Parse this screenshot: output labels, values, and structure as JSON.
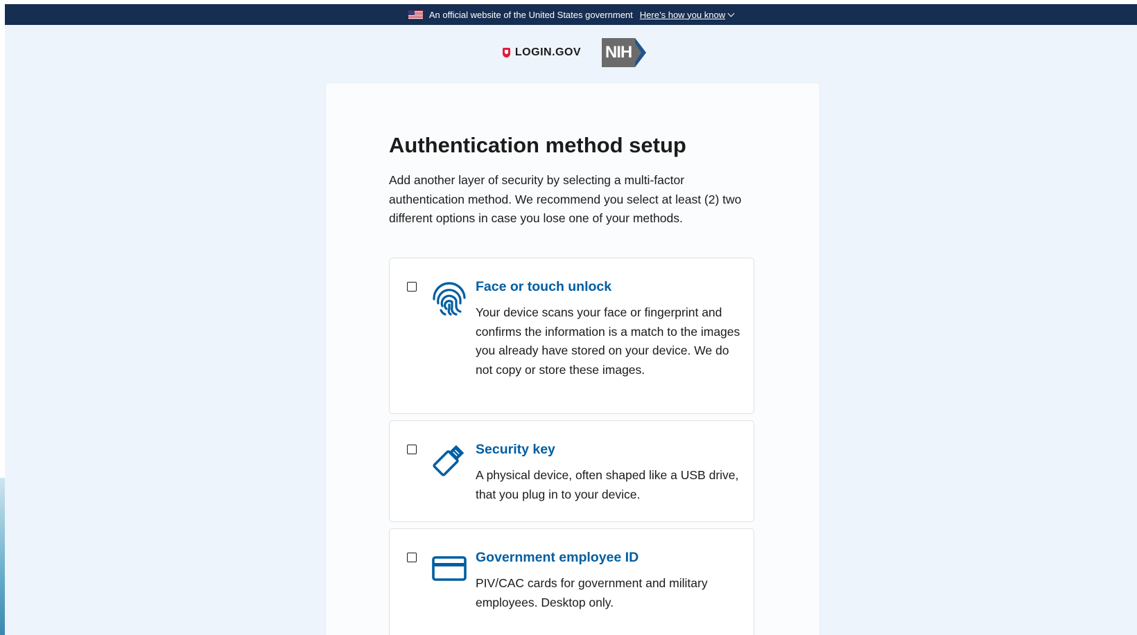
{
  "banner": {
    "text": "An official website of the United States government",
    "link_label": "Here’s how you know"
  },
  "logos": {
    "login_gov": "LOGIN.GOV",
    "nih": "NIH"
  },
  "page": {
    "title": "Authentication method setup",
    "intro": "Add another layer of security by selecting a multi-factor authentication method. We recommend you select at least (2) two different options in case you lose one of your methods."
  },
  "options": [
    {
      "icon": "fingerprint-icon",
      "title": "Face or touch unlock",
      "description": "Your device scans your face or fingerprint and confirms the information is a match to the images you already have stored on your device. We do not copy or store these images.",
      "checked": false
    },
    {
      "icon": "security-key-icon",
      "title": "Security key",
      "description": "A physical device, often shaped like a USB drive, that you plug in to your device.",
      "checked": false
    },
    {
      "icon": "id-card-icon",
      "title": "Government employee ID",
      "description": "PIV/CAC cards for government and military employees. Desktop only.",
      "checked": false
    }
  ],
  "colors": {
    "banner_bg": "#162e51",
    "link_blue": "#005ea2",
    "page_bg": "#eef4fb",
    "shield_red": "#e21c3d"
  }
}
